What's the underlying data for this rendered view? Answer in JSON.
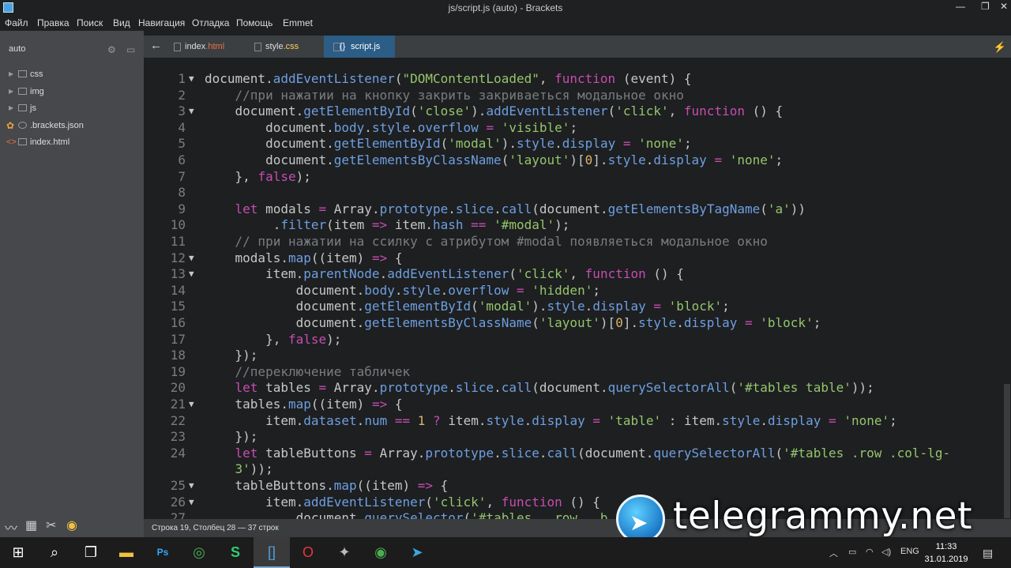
{
  "window": {
    "title": "js/script.js (auto) - Brackets",
    "minimize": "—",
    "restore": "❐",
    "close": "✕"
  },
  "menu": [
    "Файл",
    "Правка",
    "Поиск",
    "Вид",
    "Навигация",
    "Отладка",
    "Помощь",
    "Emmet"
  ],
  "sidebar": {
    "project": "auto",
    "tree": [
      {
        "label": "css",
        "type": "folder"
      },
      {
        "label": "img",
        "type": "folder"
      },
      {
        "label": "js",
        "type": "folder"
      },
      {
        "label": ".brackets.json",
        "type": "file"
      },
      {
        "label": "index.html",
        "type": "file"
      }
    ]
  },
  "tabs": [
    {
      "label_a": "index",
      "label_b": ".html",
      "active": false
    },
    {
      "label_a": "style",
      "label_b": ".css",
      "active": false
    },
    {
      "label_a": "script",
      "label_b": ".js",
      "active": true
    }
  ],
  "editor": {
    "lines": [
      {
        "n": "1",
        "fold": true,
        "html": "document.<span class='fn'>addEventListener</span>(<span class='s'>\"DOMContentLoaded\"</span>, <span class='k'>function</span> (event) {"
      },
      {
        "n": "2",
        "fold": false,
        "html": "    <span class='c'>//при нажатии на кнопку закрить закриваеться модальное окно</span>"
      },
      {
        "n": "3",
        "fold": true,
        "html": "    document.<span class='fn'>getElementById</span>(<span class='s'>'close'</span>).<span class='fn'>addEventListener</span>(<span class='s'>'click'</span>, <span class='k'>function</span> () {"
      },
      {
        "n": "4",
        "fold": false,
        "html": "        document.<span class='fn'>body</span>.<span class='fn'>style</span>.<span class='fn'>overflow</span> <span class='o'>=</span> <span class='s'>'visible'</span>;"
      },
      {
        "n": "5",
        "fold": false,
        "html": "        document.<span class='fn'>getElementById</span>(<span class='s'>'modal'</span>).<span class='fn'>style</span>.<span class='fn'>display</span> <span class='o'>=</span> <span class='s'>'none'</span>;"
      },
      {
        "n": "6",
        "fold": false,
        "html": "        document.<span class='fn'>getElementsByClassName</span>(<span class='s'>'layout'</span>)[<span class='n'>0</span>].<span class='fn'>style</span>.<span class='fn'>display</span> <span class='o'>=</span> <span class='s'>'none'</span>;"
      },
      {
        "n": "7",
        "fold": false,
        "html": "    }, <span class='k'>false</span>);"
      },
      {
        "n": "8",
        "fold": false,
        "html": ""
      },
      {
        "n": "9",
        "fold": false,
        "html": "    <span class='k'>let</span> modals <span class='o'>=</span> Array.<span class='fn'>prototype</span>.<span class='fn'>slice</span>.<span class='fn'>call</span>(document.<span class='fn'>getElementsByTagName</span>(<span class='s'>'a'</span>))"
      },
      {
        "n": "10",
        "fold": false,
        "html": "         .<span class='fn'>filter</span>(item <span class='o'>=&gt;</span> item.<span class='fn'>hash</span> <span class='o'>==</span> <span class='s'>'#modal'</span>);"
      },
      {
        "n": "11",
        "fold": false,
        "html": "    <span class='c'>// при нажатии на ссилку с атрибутом #modal появляеться модальное окно</span>"
      },
      {
        "n": "12",
        "fold": true,
        "html": "    modals.<span class='fn'>map</span>((item) <span class='o'>=&gt;</span> {"
      },
      {
        "n": "13",
        "fold": true,
        "html": "        item.<span class='fn'>parentNode</span>.<span class='fn'>addEventListener</span>(<span class='s'>'click'</span>, <span class='k'>function</span> () {"
      },
      {
        "n": "14",
        "fold": false,
        "html": "            document.<span class='fn'>body</span>.<span class='fn'>style</span>.<span class='fn'>overflow</span> <span class='o'>=</span> <span class='s'>'hidden'</span>;"
      },
      {
        "n": "15",
        "fold": false,
        "html": "            document.<span class='fn'>getElementById</span>(<span class='s'>'modal'</span>).<span class='fn'>style</span>.<span class='fn'>display</span> <span class='o'>=</span> <span class='s'>'block'</span>;"
      },
      {
        "n": "16",
        "fold": false,
        "html": "            document.<span class='fn'>getElementsByClassName</span>(<span class='s'>'layout'</span>)[<span class='n'>0</span>].<span class='fn'>style</span>.<span class='fn'>display</span> <span class='o'>=</span> <span class='s'>'block'</span>;"
      },
      {
        "n": "17",
        "fold": false,
        "html": "        }, <span class='k'>false</span>);"
      },
      {
        "n": "18",
        "fold": false,
        "html": "    });"
      },
      {
        "n": "19",
        "fold": false,
        "html": "    <span class='c'>//переключение табличек</span>"
      },
      {
        "n": "20",
        "fold": false,
        "html": "    <span class='k'>let</span> tables <span class='o'>=</span> Array.<span class='fn'>prototype</span>.<span class='fn'>slice</span>.<span class='fn'>call</span>(document.<span class='fn'>querySelectorAll</span>(<span class='s'>'#tables table'</span>));"
      },
      {
        "n": "21",
        "fold": true,
        "html": "    tables.<span class='fn'>map</span>((item) <span class='o'>=&gt;</span> {"
      },
      {
        "n": "22",
        "fold": false,
        "html": "        item.<span class='fn'>dataset</span>.<span class='fn'>num</span> <span class='o'>==</span> <span class='n'>1</span> <span class='o'>?</span> item.<span class='fn'>style</span>.<span class='fn'>display</span> <span class='o'>=</span> <span class='s'>'table'</span> : item.<span class='fn'>style</span>.<span class='fn'>display</span> <span class='o'>=</span> <span class='s'>'none'</span>;"
      },
      {
        "n": "23",
        "fold": false,
        "html": "    });"
      },
      {
        "n": "24",
        "fold": false,
        "html": "    <span class='k'>let</span> tableButtons <span class='o'>=</span> Array.<span class='fn'>prototype</span>.<span class='fn'>slice</span>.<span class='fn'>call</span>(document.<span class='fn'>querySelectorAll</span>(<span class='s'>'#tables .row .col-lg-</span>"
      },
      {
        "n": "",
        "fold": false,
        "html": "    <span class='s'>3'</span>));"
      },
      {
        "n": "25",
        "fold": true,
        "html": "    tableButtons.<span class='fn'>map</span>((item) <span class='o'>=&gt;</span> {"
      },
      {
        "n": "26",
        "fold": true,
        "html": "        item.<span class='fn'>addEventListener</span>(<span class='s'>'click'</span>, <span class='k'>function</span> () {"
      },
      {
        "n": "27",
        "fold": false,
        "html": "            document.<span class='fn'>querySelector</span>(<span class='s'>'#tables  .row  .b</span>"
      }
    ]
  },
  "status": {
    "position": "Строка 19, Столбец 28 — 37 строк"
  },
  "watermark": {
    "text": "telegrammy.net"
  },
  "taskbar": {
    "lang": "ENG",
    "time": "11:33",
    "date": "31.01.2019"
  }
}
